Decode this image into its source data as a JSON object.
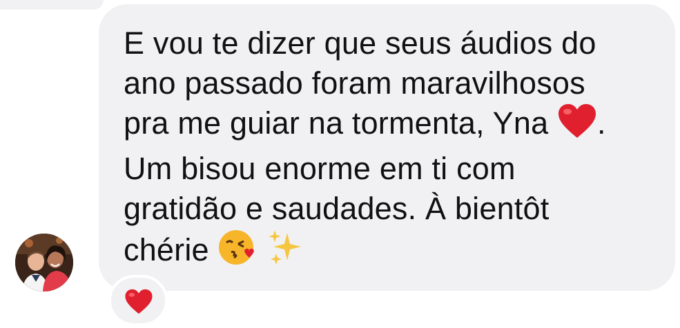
{
  "message": {
    "line1": "E vou te dizer que seus áudios do",
    "line2": "ano passado foram maravilhosos",
    "line3_text": "pra me guiar na tormenta, Yna ",
    "line3_emoji": "red-heart-emoji",
    "line3_end": ".",
    "line4": "Um bisou enorme em ti com",
    "line5": "gratidão e saudades. À bientôt",
    "line6_text": "chérie ",
    "line6_emojis": [
      "face-blowing-kiss-emoji",
      "sparkles-emoji"
    ]
  },
  "reaction": {
    "emoji": "red-heart-emoji"
  },
  "colors": {
    "bubble": "#f1f1f3",
    "text": "#111111",
    "heart": "#e0202e",
    "kiss_face": "#f7b52a",
    "sparkles": "#f6c640"
  }
}
